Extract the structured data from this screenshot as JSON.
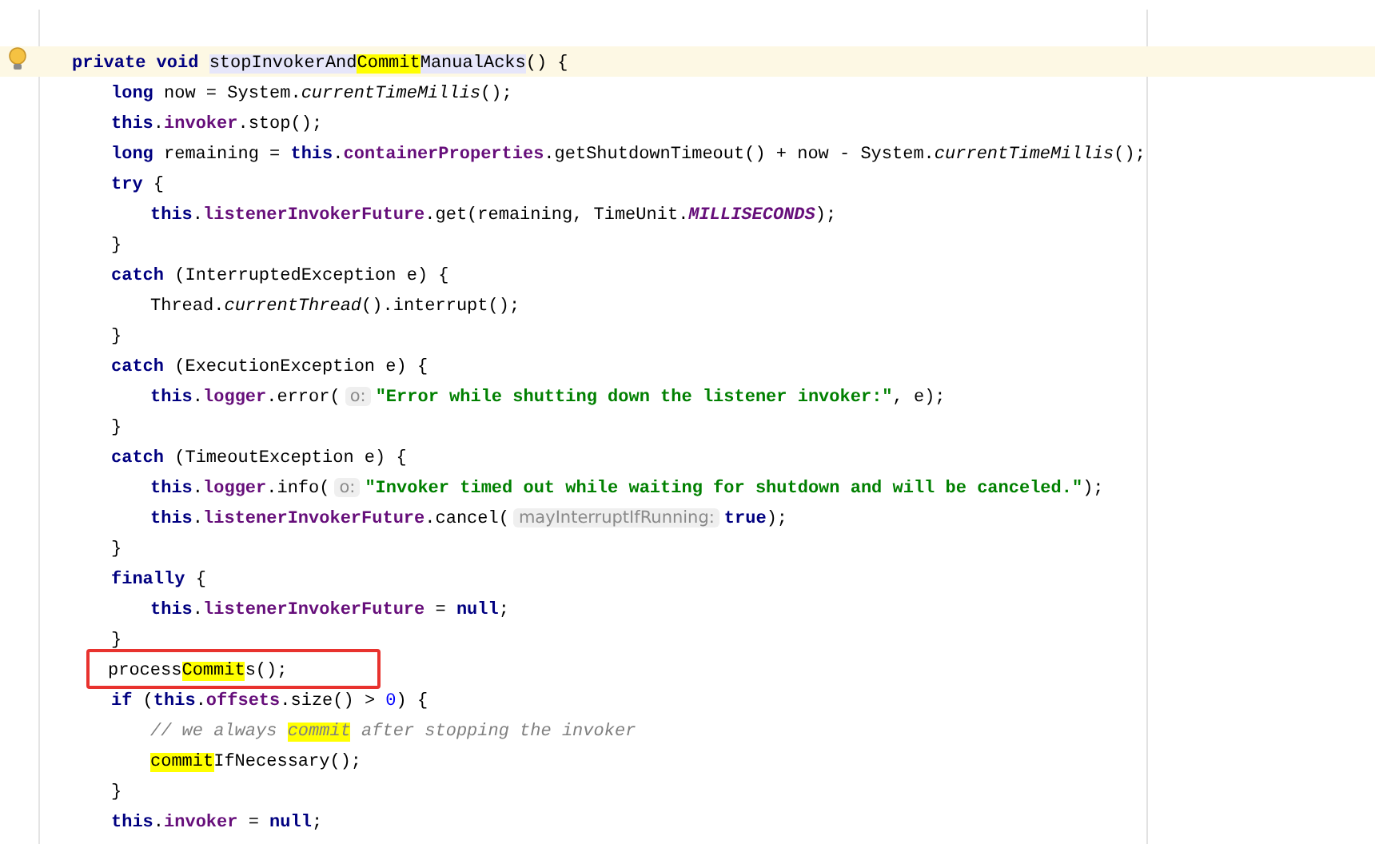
{
  "editor": {
    "lines": [
      {
        "current": true,
        "tokens": [
          {
            "text": "private void ",
            "kind": "keyword"
          },
          {
            "text": "stopInvokerAnd",
            "kind": "declaration"
          },
          {
            "text": "Commit",
            "kind": "declaration",
            "highlight": true
          },
          {
            "text": "ManualAcks",
            "kind": "declaration"
          },
          {
            "text": "() {",
            "kind": "plain"
          }
        ],
        "children": [
          {
            "tokens": [
              {
                "text": "long",
                "kind": "keyword"
              },
              {
                "text": " now = System.",
                "kind": "plain"
              },
              {
                "text": "currentTimeMillis",
                "kind": "static"
              },
              {
                "text": "();",
                "kind": "plain"
              }
            ]
          },
          {
            "tokens": [
              {
                "text": "this",
                "kind": "keyword"
              },
              {
                "text": ".",
                "kind": "plain"
              },
              {
                "text": "invoker",
                "kind": "field"
              },
              {
                "text": ".stop();",
                "kind": "plain"
              }
            ]
          },
          {
            "tokens": [
              {
                "text": "long",
                "kind": "keyword"
              },
              {
                "text": " remaining = ",
                "kind": "plain"
              },
              {
                "text": "this",
                "kind": "keyword"
              },
              {
                "text": ".",
                "kind": "plain"
              },
              {
                "text": "containerProperties",
                "kind": "field"
              },
              {
                "text": ".getShutdownTimeout() + now - System.",
                "kind": "plain"
              },
              {
                "text": "currentTimeMillis",
                "kind": "static"
              },
              {
                "text": "();",
                "kind": "plain"
              }
            ]
          },
          {
            "tokens": [
              {
                "text": "try",
                "kind": "keyword"
              },
              {
                "text": " {",
                "kind": "plain"
              }
            ],
            "children": [
              {
                "tokens": [
                  {
                    "text": "this",
                    "kind": "keyword"
                  },
                  {
                    "text": ".",
                    "kind": "plain"
                  },
                  {
                    "text": "listenerInvokerFuture",
                    "kind": "field"
                  },
                  {
                    "text": ".get(remaining, TimeUnit.",
                    "kind": "plain"
                  },
                  {
                    "text": "MILLISECONDS",
                    "kind": "constant"
                  },
                  {
                    "text": ");",
                    "kind": "plain"
                  }
                ]
              }
            ]
          },
          {
            "tokens": [
              {
                "text": "}",
                "kind": "plain"
              }
            ]
          },
          {
            "tokens": [
              {
                "text": "catch",
                "kind": "keyword"
              },
              {
                "text": " (InterruptedException e) {",
                "kind": "plain"
              }
            ],
            "children": [
              {
                "tokens": [
                  {
                    "text": "Thread.",
                    "kind": "plain"
                  },
                  {
                    "text": "currentThread",
                    "kind": "static"
                  },
                  {
                    "text": "().interrupt();",
                    "kind": "plain"
                  }
                ]
              }
            ]
          },
          {
            "tokens": [
              {
                "text": "}",
                "kind": "plain"
              }
            ]
          },
          {
            "tokens": [
              {
                "text": "catch",
                "kind": "keyword"
              },
              {
                "text": " (ExecutionException e) {",
                "kind": "plain"
              }
            ],
            "children": [
              {
                "tokens": [
                  {
                    "text": "this",
                    "kind": "keyword"
                  },
                  {
                    "text": ".",
                    "kind": "plain"
                  },
                  {
                    "text": "logger",
                    "kind": "field"
                  },
                  {
                    "text": ".error(",
                    "kind": "plain"
                  },
                  {
                    "text": "o:",
                    "kind": "hint"
                  },
                  {
                    "text": "\"Error while shutting down the listener invoker:\"",
                    "kind": "string"
                  },
                  {
                    "text": ", e);",
                    "kind": "plain"
                  }
                ]
              }
            ]
          },
          {
            "tokens": [
              {
                "text": "}",
                "kind": "plain"
              }
            ]
          },
          {
            "tokens": [
              {
                "text": "catch",
                "kind": "keyword"
              },
              {
                "text": " (TimeoutException e) {",
                "kind": "plain"
              }
            ],
            "children": [
              {
                "tokens": [
                  {
                    "text": "this",
                    "kind": "keyword"
                  },
                  {
                    "text": ".",
                    "kind": "plain"
                  },
                  {
                    "text": "logger",
                    "kind": "field"
                  },
                  {
                    "text": ".info(",
                    "kind": "plain"
                  },
                  {
                    "text": "o:",
                    "kind": "hint"
                  },
                  {
                    "text": "\"Invoker timed out while waiting for shutdown and will be canceled.\"",
                    "kind": "string"
                  },
                  {
                    "text": ");",
                    "kind": "plain"
                  }
                ]
              },
              {
                "tokens": [
                  {
                    "text": "this",
                    "kind": "keyword"
                  },
                  {
                    "text": ".",
                    "kind": "plain"
                  },
                  {
                    "text": "listenerInvokerFuture",
                    "kind": "field"
                  },
                  {
                    "text": ".cancel(",
                    "kind": "plain"
                  },
                  {
                    "text": "mayInterruptIfRunning:",
                    "kind": "hint"
                  },
                  {
                    "text": "true",
                    "kind": "keyword"
                  },
                  {
                    "text": ");",
                    "kind": "plain"
                  }
                ]
              }
            ]
          },
          {
            "tokens": [
              {
                "text": "}",
                "kind": "plain"
              }
            ]
          },
          {
            "tokens": [
              {
                "text": "finally",
                "kind": "keyword"
              },
              {
                "text": " {",
                "kind": "plain"
              }
            ],
            "children": [
              {
                "tokens": [
                  {
                    "text": "this",
                    "kind": "keyword"
                  },
                  {
                    "text": ".",
                    "kind": "plain"
                  },
                  {
                    "text": "listenerInvokerFuture",
                    "kind": "field"
                  },
                  {
                    "text": " = ",
                    "kind": "plain"
                  },
                  {
                    "text": "null",
                    "kind": "keyword"
                  },
                  {
                    "text": ";",
                    "kind": "plain"
                  }
                ]
              }
            ]
          },
          {
            "tokens": [
              {
                "text": "}",
                "kind": "plain"
              }
            ]
          },
          {
            "boxed": true,
            "tokens": [
              {
                "text": "process",
                "kind": "plain"
              },
              {
                "text": "Commit",
                "kind": "plain",
                "highlight": true
              },
              {
                "text": "s();",
                "kind": "plain"
              }
            ]
          },
          {
            "tokens": [
              {
                "text": "if",
                "kind": "keyword"
              },
              {
                "text": " (",
                "kind": "plain"
              },
              {
                "text": "this",
                "kind": "keyword"
              },
              {
                "text": ".",
                "kind": "plain"
              },
              {
                "text": "offsets",
                "kind": "field"
              },
              {
                "text": ".size() > ",
                "kind": "plain"
              },
              {
                "text": "0",
                "kind": "number"
              },
              {
                "text": ") {",
                "kind": "plain"
              }
            ],
            "children": [
              {
                "tokens": [
                  {
                    "text": "// we always ",
                    "kind": "comment"
                  },
                  {
                    "text": "commit",
                    "kind": "comment",
                    "highlight": true
                  },
                  {
                    "text": " after stopping the invoker",
                    "kind": "comment"
                  }
                ]
              },
              {
                "tokens": [
                  {
                    "text": "commit",
                    "kind": "plain",
                    "highlight": true
                  },
                  {
                    "text": "IfNecessary();",
                    "kind": "plain"
                  }
                ]
              }
            ]
          },
          {
            "tokens": [
              {
                "text": "}",
                "kind": "plain"
              }
            ]
          },
          {
            "tokens": [
              {
                "text": "this",
                "kind": "keyword"
              },
              {
                "text": ".",
                "kind": "plain"
              },
              {
                "text": "invoker",
                "kind": "field"
              },
              {
                "text": " = ",
                "kind": "plain"
              },
              {
                "text": "null",
                "kind": "keyword"
              },
              {
                "text": ";",
                "kind": "plain"
              }
            ]
          }
        ]
      }
    ]
  }
}
